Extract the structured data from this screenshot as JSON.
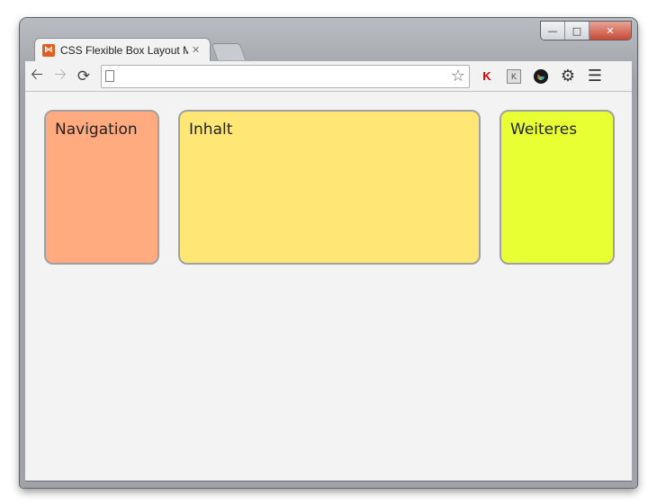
{
  "window": {
    "controls": [
      "minimize",
      "maximize",
      "close"
    ]
  },
  "tab": {
    "title": "CSS Flexible Box Layout Mc",
    "favicon": "xampp-icon"
  },
  "toolbar": {
    "back_icon": "back-arrow-icon",
    "forward_icon": "forward-arrow-icon",
    "reload_icon": "reload-icon",
    "address_value": "",
    "extensions": [
      "kaspersky-icon",
      "kaspersky-keyboard-icon",
      "color-picker-icon"
    ]
  },
  "page": {
    "boxes": [
      {
        "label": "Navigation",
        "color": "#ffaa7f"
      },
      {
        "label": "Inhalt",
        "color": "#ffe675"
      },
      {
        "label": "Weiteres",
        "color": "#e7ff33"
      }
    ]
  }
}
